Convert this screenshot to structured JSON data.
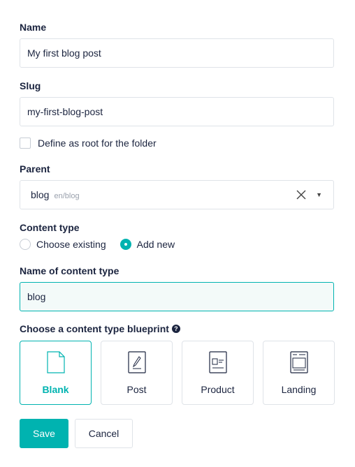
{
  "name": {
    "label": "Name",
    "value": "My first blog post"
  },
  "slug": {
    "label": "Slug",
    "value": "my-first-blog-post"
  },
  "root_checkbox": {
    "label": "Define as root for the folder",
    "checked": false
  },
  "parent": {
    "label": "Parent",
    "value": "blog",
    "path": "en/blog"
  },
  "content_type": {
    "label": "Content type",
    "options": [
      {
        "label": "Choose existing",
        "selected": false
      },
      {
        "label": "Add new",
        "selected": true
      }
    ]
  },
  "content_type_name": {
    "label": "Name of content type",
    "value": "blog"
  },
  "blueprint": {
    "label": "Choose a content type blueprint",
    "options": [
      {
        "label": "Blank",
        "icon": "blank-document-icon",
        "selected": true
      },
      {
        "label": "Post",
        "icon": "post-icon",
        "selected": false
      },
      {
        "label": "Product",
        "icon": "product-icon",
        "selected": false
      },
      {
        "label": "Landing",
        "icon": "landing-icon",
        "selected": false
      }
    ]
  },
  "actions": {
    "save_label": "Save",
    "cancel_label": "Cancel"
  },
  "colors": {
    "accent": "#00b3b0",
    "text": "#1b243f",
    "border": "#dfe3e8",
    "active_bg": "#f3faf9"
  }
}
